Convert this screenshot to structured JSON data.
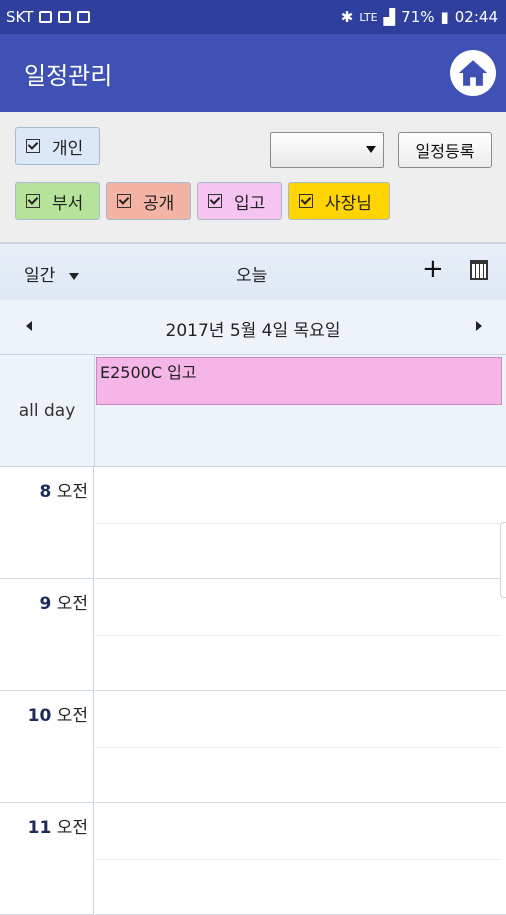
{
  "status_bar": {
    "carrier": "SKT",
    "network": "LTE",
    "battery": "71%",
    "time": "02:44"
  },
  "app_bar": {
    "title": "일정관리",
    "home_icon": "home-icon"
  },
  "filters": {
    "personal": {
      "label": "개인",
      "checked": true,
      "color": "#dce8f8"
    },
    "department": {
      "label": "부서",
      "checked": true,
      "color": "#b6e39a"
    },
    "public": {
      "label": "공개",
      "checked": true,
      "color": "#f4b4a5"
    },
    "incoming": {
      "label": "입고",
      "checked": true,
      "color": "#f5c4f0"
    },
    "boss": {
      "label": "사장님",
      "checked": true,
      "color": "#ffd400"
    },
    "select_value": "",
    "register_button": "일정등록"
  },
  "calendar_header": {
    "view": "일간",
    "today": "오늘",
    "add": "+"
  },
  "date_nav": {
    "date": "2017년 5월 4일 목요일"
  },
  "all_day": {
    "label": "all day",
    "events": [
      {
        "title": "E2500C 입고",
        "color": "#f5b5e6"
      }
    ]
  },
  "hours": [
    {
      "num": "8",
      "ampm": "오전"
    },
    {
      "num": "9",
      "ampm": "오전"
    },
    {
      "num": "10",
      "ampm": "오전"
    },
    {
      "num": "11",
      "ampm": "오전"
    }
  ]
}
